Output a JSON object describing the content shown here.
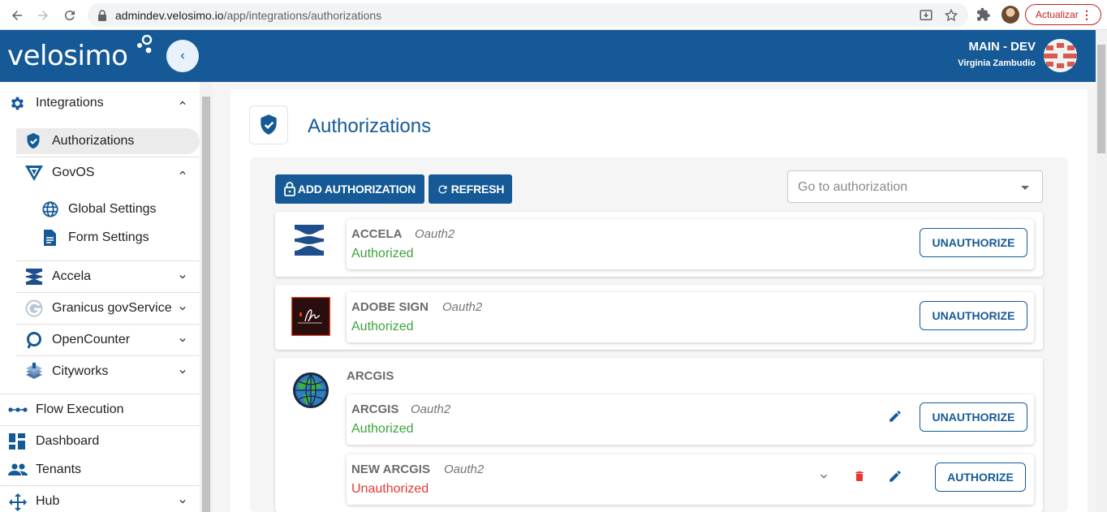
{
  "browser": {
    "url_host": "admindev.velosimo.io",
    "url_path": "/app/integrations/authorizations",
    "update_label": "Actualizar",
    "icons": [
      "back-icon",
      "forward-icon",
      "reload-icon",
      "lock-icon",
      "install-icon",
      "star-icon",
      "extensions-icon",
      "more-icon"
    ]
  },
  "header": {
    "logo": "velosimo",
    "environment": "MAIN - DEV",
    "user": "Virginia Zambudio",
    "brand_color": "#155a96"
  },
  "sidebar": {
    "integrations": "Integrations",
    "authorizations": "Authorizations",
    "govos": "GovOS",
    "global_settings": "Global Settings",
    "form_settings": "Form Settings",
    "accela": "Accela",
    "granicus": "Granicus govService",
    "opencounter": "OpenCounter",
    "cityworks": "Cityworks",
    "flow_execution": "Flow Execution",
    "dashboard": "Dashboard",
    "tenants": "Tenants",
    "hub": "Hub"
  },
  "main": {
    "title": "Authorizations",
    "add_button": "ADD AUTHORIZATION",
    "refresh_button": "REFRESH",
    "goto_placeholder": "Go to authorization",
    "providers": [
      {
        "name": "ACCELA",
        "auths": [
          {
            "name": "ACCELA",
            "type": "Oauth2",
            "status": "Authorized",
            "action": "UNAUTHORIZE"
          }
        ]
      },
      {
        "name": "ADOBE SIGN",
        "auths": [
          {
            "name": "ADOBE SIGN",
            "type": "Oauth2",
            "status": "Authorized",
            "action": "UNAUTHORIZE"
          }
        ]
      },
      {
        "name": "ARCGIS",
        "auths": [
          {
            "name": "ARCGIS",
            "type": "Oauth2",
            "status": "Authorized",
            "action": "UNAUTHORIZE"
          },
          {
            "name": "NEW ARCGIS",
            "type": "Oauth2",
            "status": "Unauthorized",
            "action": "AUTHORIZE"
          }
        ]
      }
    ],
    "status_colors": {
      "authorized": "#3aa53a",
      "unauthorized": "#e53935"
    }
  }
}
